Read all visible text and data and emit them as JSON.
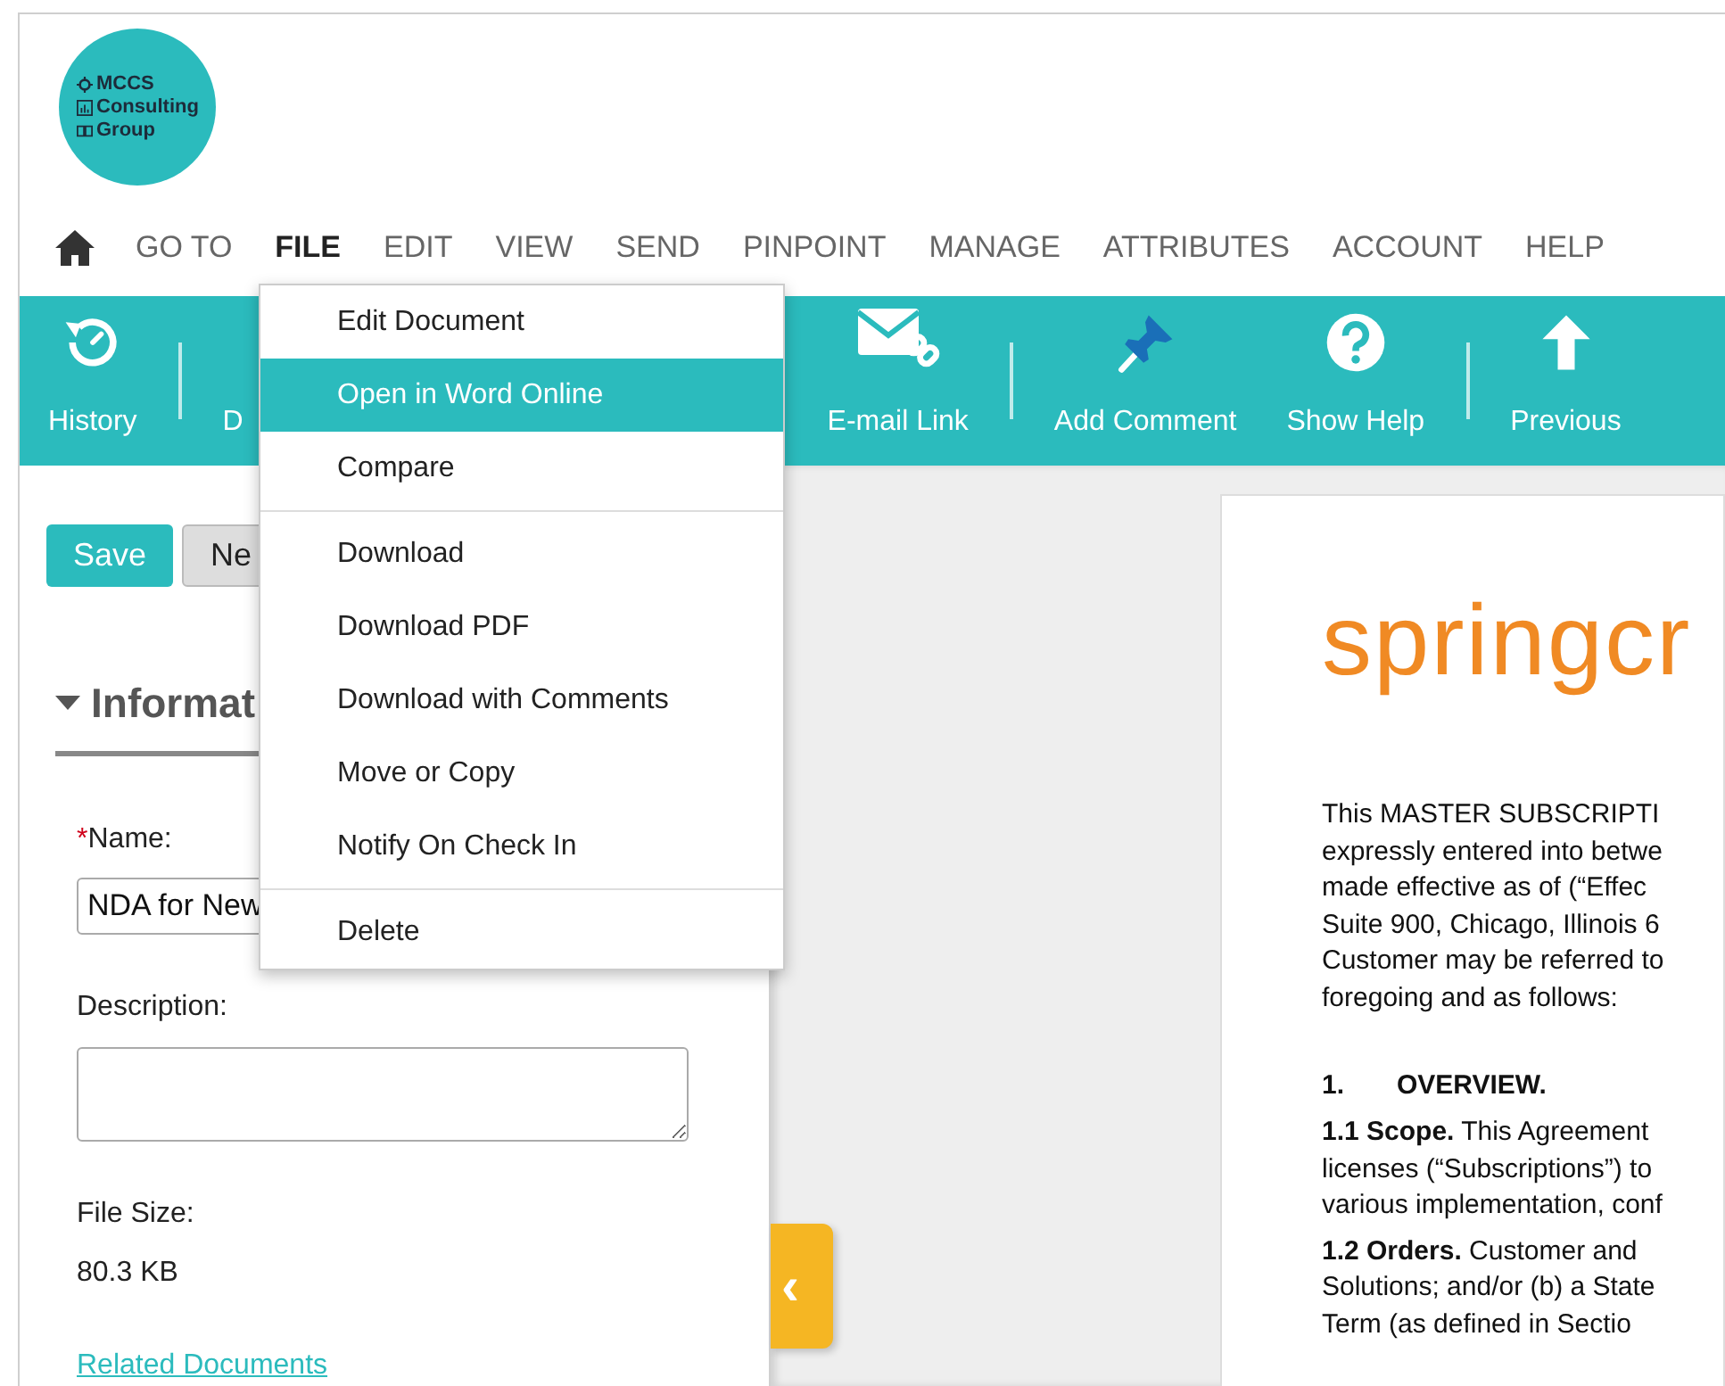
{
  "logo": {
    "lines": [
      "MCCS",
      "Consulting",
      "Group"
    ]
  },
  "nav": [
    {
      "label": "GO TO",
      "selected": false
    },
    {
      "label": "FILE",
      "selected": true
    },
    {
      "label": "EDIT",
      "selected": false
    },
    {
      "label": "VIEW",
      "selected": false
    },
    {
      "label": "SEND",
      "selected": false
    },
    {
      "label": "PINPOINT",
      "selected": false
    },
    {
      "label": "MANAGE",
      "selected": false
    },
    {
      "label": "ATTRIBUTES",
      "selected": false
    },
    {
      "label": "ACCOUNT",
      "selected": false
    },
    {
      "label": "HELP",
      "selected": false
    }
  ],
  "toolbar": [
    {
      "kind": "history",
      "label": "History",
      "divider_after": true
    },
    {
      "kind": "partial",
      "label": "D",
      "divider_after": false
    },
    {
      "kind": "email",
      "label": "E-mail Link",
      "divider_after": true
    },
    {
      "kind": "pin",
      "label": "Add Comment",
      "divider_after": false
    },
    {
      "kind": "help",
      "label": "Show Help",
      "divider_after": true
    },
    {
      "kind": "up",
      "label": "Previous",
      "divider_after": false
    }
  ],
  "file_menu": [
    [
      {
        "label": "Edit Document",
        "selected": false
      },
      {
        "label": "Open in Word Online",
        "selected": true
      },
      {
        "label": "Compare",
        "selected": false
      }
    ],
    [
      {
        "label": "Download",
        "selected": false
      },
      {
        "label": "Download PDF",
        "selected": false
      },
      {
        "label": "Download with Comments",
        "selected": false
      },
      {
        "label": "Move or Copy",
        "selected": false
      },
      {
        "label": "Notify On Check In",
        "selected": false
      }
    ],
    [
      {
        "label": "Delete",
        "selected": false
      }
    ]
  ],
  "panel": {
    "buttons": [
      {
        "kind": "primary",
        "label": "Save"
      },
      {
        "kind": "secondary",
        "label": "Ne"
      }
    ],
    "section": {
      "title": "Informat",
      "expanded": true
    },
    "name": {
      "required_mark": "*",
      "label": "Name:",
      "value": "NDA for New"
    },
    "description": {
      "label": "Description:"
    },
    "file_size": {
      "label": "File Size:",
      "value": "80.3 KB"
    },
    "link": "Related Documents"
  },
  "collapse_tab": {
    "glyph": "‹"
  },
  "document": {
    "logo": "springcr",
    "lines": [
      {
        "kind": "text",
        "text": "This MASTER SUBSCRIPTI"
      },
      {
        "kind": "text",
        "text": "expressly entered into betwe"
      },
      {
        "kind": "text",
        "text": "made effective as of (“Effec"
      },
      {
        "kind": "text",
        "text": "Suite 900, Chicago, Illinois 6"
      },
      {
        "kind": "text",
        "text": "Customer may be referred to"
      },
      {
        "kind": "text",
        "text": "foregoing and as follows:"
      },
      {
        "kind": "heading",
        "number": "1.",
        "text": "OVERVIEW."
      },
      {
        "kind": "text",
        "text": "**1.1 Scope.** This Agreement"
      },
      {
        "kind": "text",
        "text": "licenses (“Subscriptions”) to"
      },
      {
        "kind": "text",
        "text": "various implementation, conf"
      },
      {
        "kind": "text",
        "text": "**1.2 Orders.** Customer and"
      },
      {
        "kind": "text",
        "text": "Solutions; and/or (b) a State"
      },
      {
        "kind": "text",
        "text": "Term (as defined in Sectio"
      }
    ]
  }
}
